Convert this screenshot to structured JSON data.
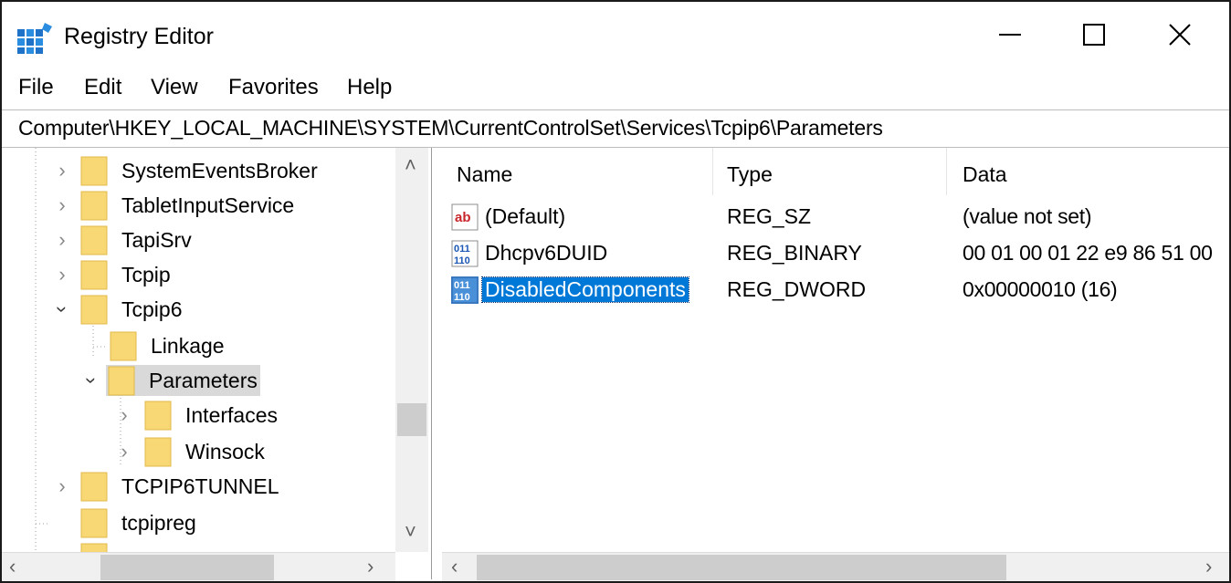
{
  "window": {
    "title": "Registry Editor"
  },
  "menu": [
    "File",
    "Edit",
    "View",
    "Favorites",
    "Help"
  ],
  "address": "Computer\\HKEY_LOCAL_MACHINE\\SYSTEM\\CurrentControlSet\\Services\\Tcpip6\\Parameters",
  "tree": {
    "items": [
      {
        "label": "SystemEventsBroker",
        "expander": "collapsed"
      },
      {
        "label": "TabletInputService",
        "expander": "collapsed"
      },
      {
        "label": "TapiSrv",
        "expander": "collapsed"
      },
      {
        "label": "Tcpip",
        "expander": "collapsed"
      },
      {
        "label": "Tcpip6",
        "expander": "expanded"
      },
      {
        "label": "Linkage",
        "expander": "none"
      },
      {
        "label": "Parameters",
        "expander": "expanded",
        "selected": true
      },
      {
        "label": "Interfaces",
        "expander": "collapsed"
      },
      {
        "label": "Winsock",
        "expander": "collapsed"
      },
      {
        "label": "TCPIP6TUNNEL",
        "expander": "collapsed"
      },
      {
        "label": "tcpipreg",
        "expander": "none"
      }
    ]
  },
  "values": {
    "headers": {
      "name": "Name",
      "type": "Type",
      "data": "Data"
    },
    "rows": [
      {
        "icon": "string-value-icon",
        "name": "(Default)",
        "type": "REG_SZ",
        "data": "(value not set)"
      },
      {
        "icon": "binary-value-icon",
        "name": "Dhcpv6DUID",
        "type": "REG_BINARY",
        "data": "00 01 00 01 22 e9 86 51 00"
      },
      {
        "icon": "binary-value-icon",
        "name": "DisabledComponents",
        "type": "REG_DWORD",
        "data": "0x00000010 (16)",
        "selected": true
      }
    ]
  },
  "colors": {
    "selection": "#0078d7",
    "folder": "#f8d775",
    "tree_selection": "#d9d9d9"
  }
}
